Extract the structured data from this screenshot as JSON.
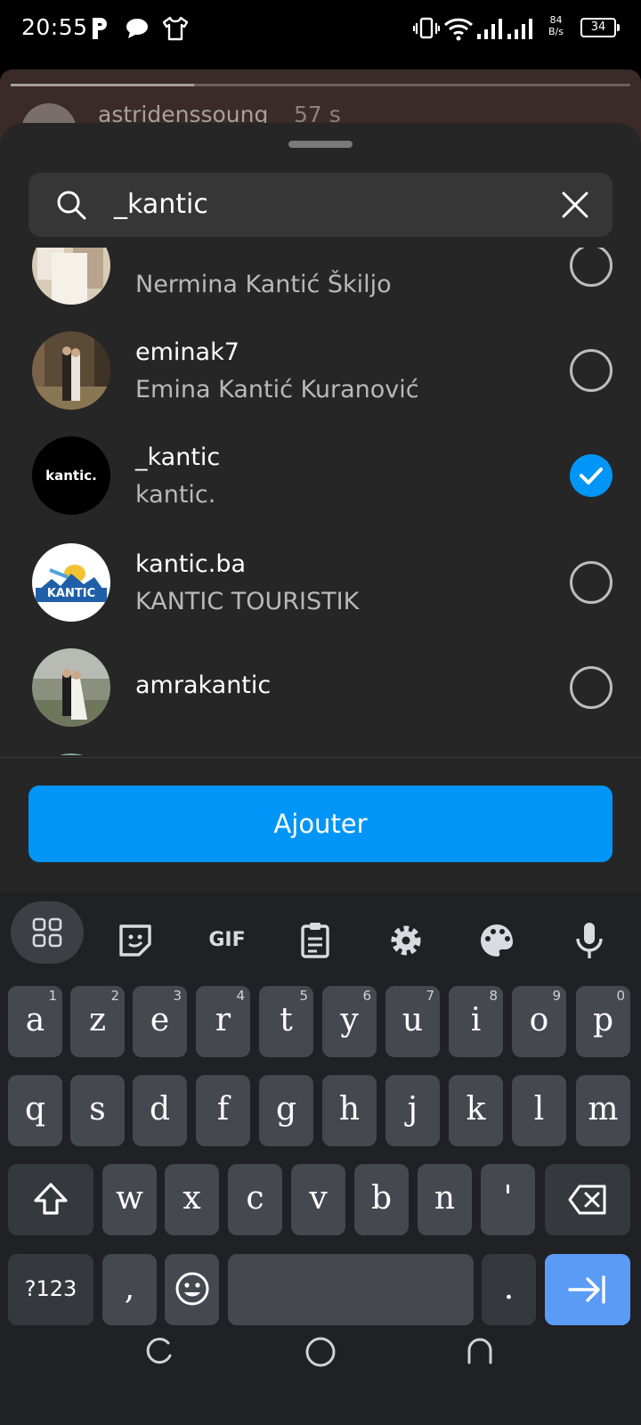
{
  "status_bar": {
    "time": "20:55",
    "net_speed_value": "84",
    "net_speed_unit": "B/s",
    "battery": "34"
  },
  "story": {
    "username": "astridenssoung",
    "time_ago": "57 s"
  },
  "search": {
    "value": "_kantic"
  },
  "results": [
    {
      "username": "",
      "full_name": "Nermina Kantić Škiljo",
      "selected": false
    },
    {
      "username": "eminak7",
      "full_name": "Emina Kantić Kuranović",
      "selected": false
    },
    {
      "username": "_kantic",
      "full_name": "kantic.",
      "selected": true,
      "avatar_text": "kantic."
    },
    {
      "username": "kantic.ba",
      "full_name": "KANTIC TOURISTIK",
      "selected": false,
      "avatar_text": "KANTIC"
    },
    {
      "username": "amrakantic",
      "full_name": "",
      "selected": false
    }
  ],
  "add_button": "Ajouter",
  "keyboard": {
    "toolbar": [
      "apps-icon",
      "sticker-icon",
      "GIF",
      "clipboard-icon",
      "settings-icon",
      "palette-icon",
      "microphone-icon"
    ],
    "gif_label": "GIF",
    "row1": [
      {
        "k": "a",
        "h": "1"
      },
      {
        "k": "z",
        "h": "2"
      },
      {
        "k": "e",
        "h": "3"
      },
      {
        "k": "r",
        "h": "4"
      },
      {
        "k": "t",
        "h": "5"
      },
      {
        "k": "y",
        "h": "6"
      },
      {
        "k": "u",
        "h": "7"
      },
      {
        "k": "i",
        "h": "8"
      },
      {
        "k": "o",
        "h": "9"
      },
      {
        "k": "p",
        "h": "0"
      }
    ],
    "row2": [
      "q",
      "s",
      "d",
      "f",
      "g",
      "h",
      "j",
      "k",
      "l",
      "m"
    ],
    "row3": [
      "w",
      "x",
      "c",
      "v",
      "b",
      "n",
      "'"
    ],
    "symbols_label": "?123",
    "comma": ",",
    "period": "."
  },
  "colors": {
    "accent": "#0095f6",
    "sheet": "#262626",
    "keyboard": "#1f2125",
    "key": "#45484e",
    "enter_key": "#5a9cf5"
  }
}
